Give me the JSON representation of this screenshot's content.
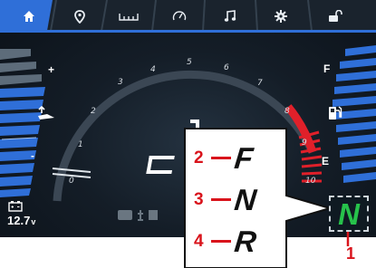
{
  "tabbar": {
    "tabs": [
      {
        "icon": "home-icon",
        "active": true
      },
      {
        "icon": "map-pin-icon",
        "active": false
      },
      {
        "icon": "trip-meter-icon",
        "active": false
      },
      {
        "icon": "gauge-icon",
        "active": false
      },
      {
        "icon": "music-note-icon",
        "active": false
      },
      {
        "icon": "gear-icon",
        "active": false
      },
      {
        "icon": "unlock-icon",
        "active": false
      }
    ]
  },
  "left_gauge": {
    "top_label": "+",
    "bottom_label": "-"
  },
  "right_gauge": {
    "top_label": "F",
    "bottom_label": "E"
  },
  "tachometer": {
    "ticks": [
      "0",
      "1",
      "2",
      "3",
      "4",
      "5",
      "6",
      "7",
      "8",
      "9",
      "10"
    ]
  },
  "battery": {
    "value": "12.7",
    "unit": "v"
  },
  "gear_callout": {
    "rows": [
      {
        "number": "2",
        "letter": "F"
      },
      {
        "number": "3",
        "letter": "N"
      },
      {
        "number": "4",
        "letter": "R"
      }
    ],
    "indicator_letter": "N",
    "indicator_number": "1"
  },
  "colors": {
    "accent_blue": "#2f6fd8",
    "redline": "#e0202a",
    "gear_green": "#27c24b",
    "callout_red": "#d9141c"
  }
}
